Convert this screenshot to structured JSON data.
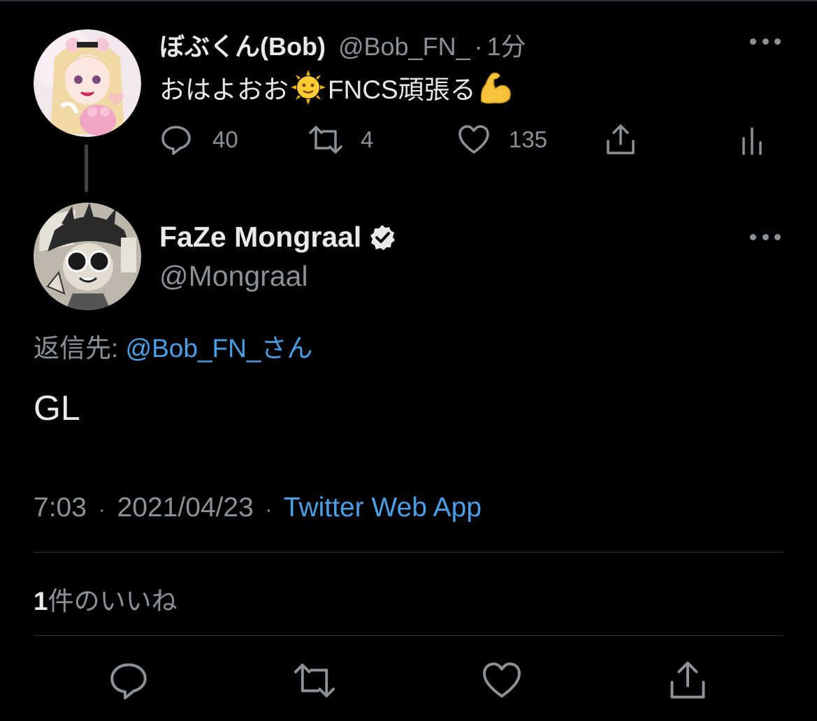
{
  "parent_tweet": {
    "display_name": "ぼぶくん(Bob)",
    "handle": "@Bob_FN_",
    "separator": "·",
    "time_ago": "1分",
    "text_part1": "おはよおお",
    "text_emoji1": "sun-with-face-emoji",
    "text_part2": "FNCS頑張る",
    "text_emoji2": "flexed-biceps-emoji",
    "actions": {
      "replies": "40",
      "retweets": "4",
      "likes": "135"
    }
  },
  "main_tweet": {
    "display_name": "FaZe Mongraal",
    "verified": true,
    "handle": "@Mongraal",
    "reply_to_prefix": "返信先: ",
    "reply_to_handle": "@Bob_FN_さん",
    "body": "GL",
    "time": "7:03",
    "separator": "·",
    "date": "2021/04/23",
    "source": "Twitter Web App",
    "likes_count": "1",
    "likes_label": "件のいいね"
  },
  "colors": {
    "background": "#000000",
    "link": "#4a9fe6",
    "muted": "#8b9196",
    "divider": "#2f3336"
  }
}
